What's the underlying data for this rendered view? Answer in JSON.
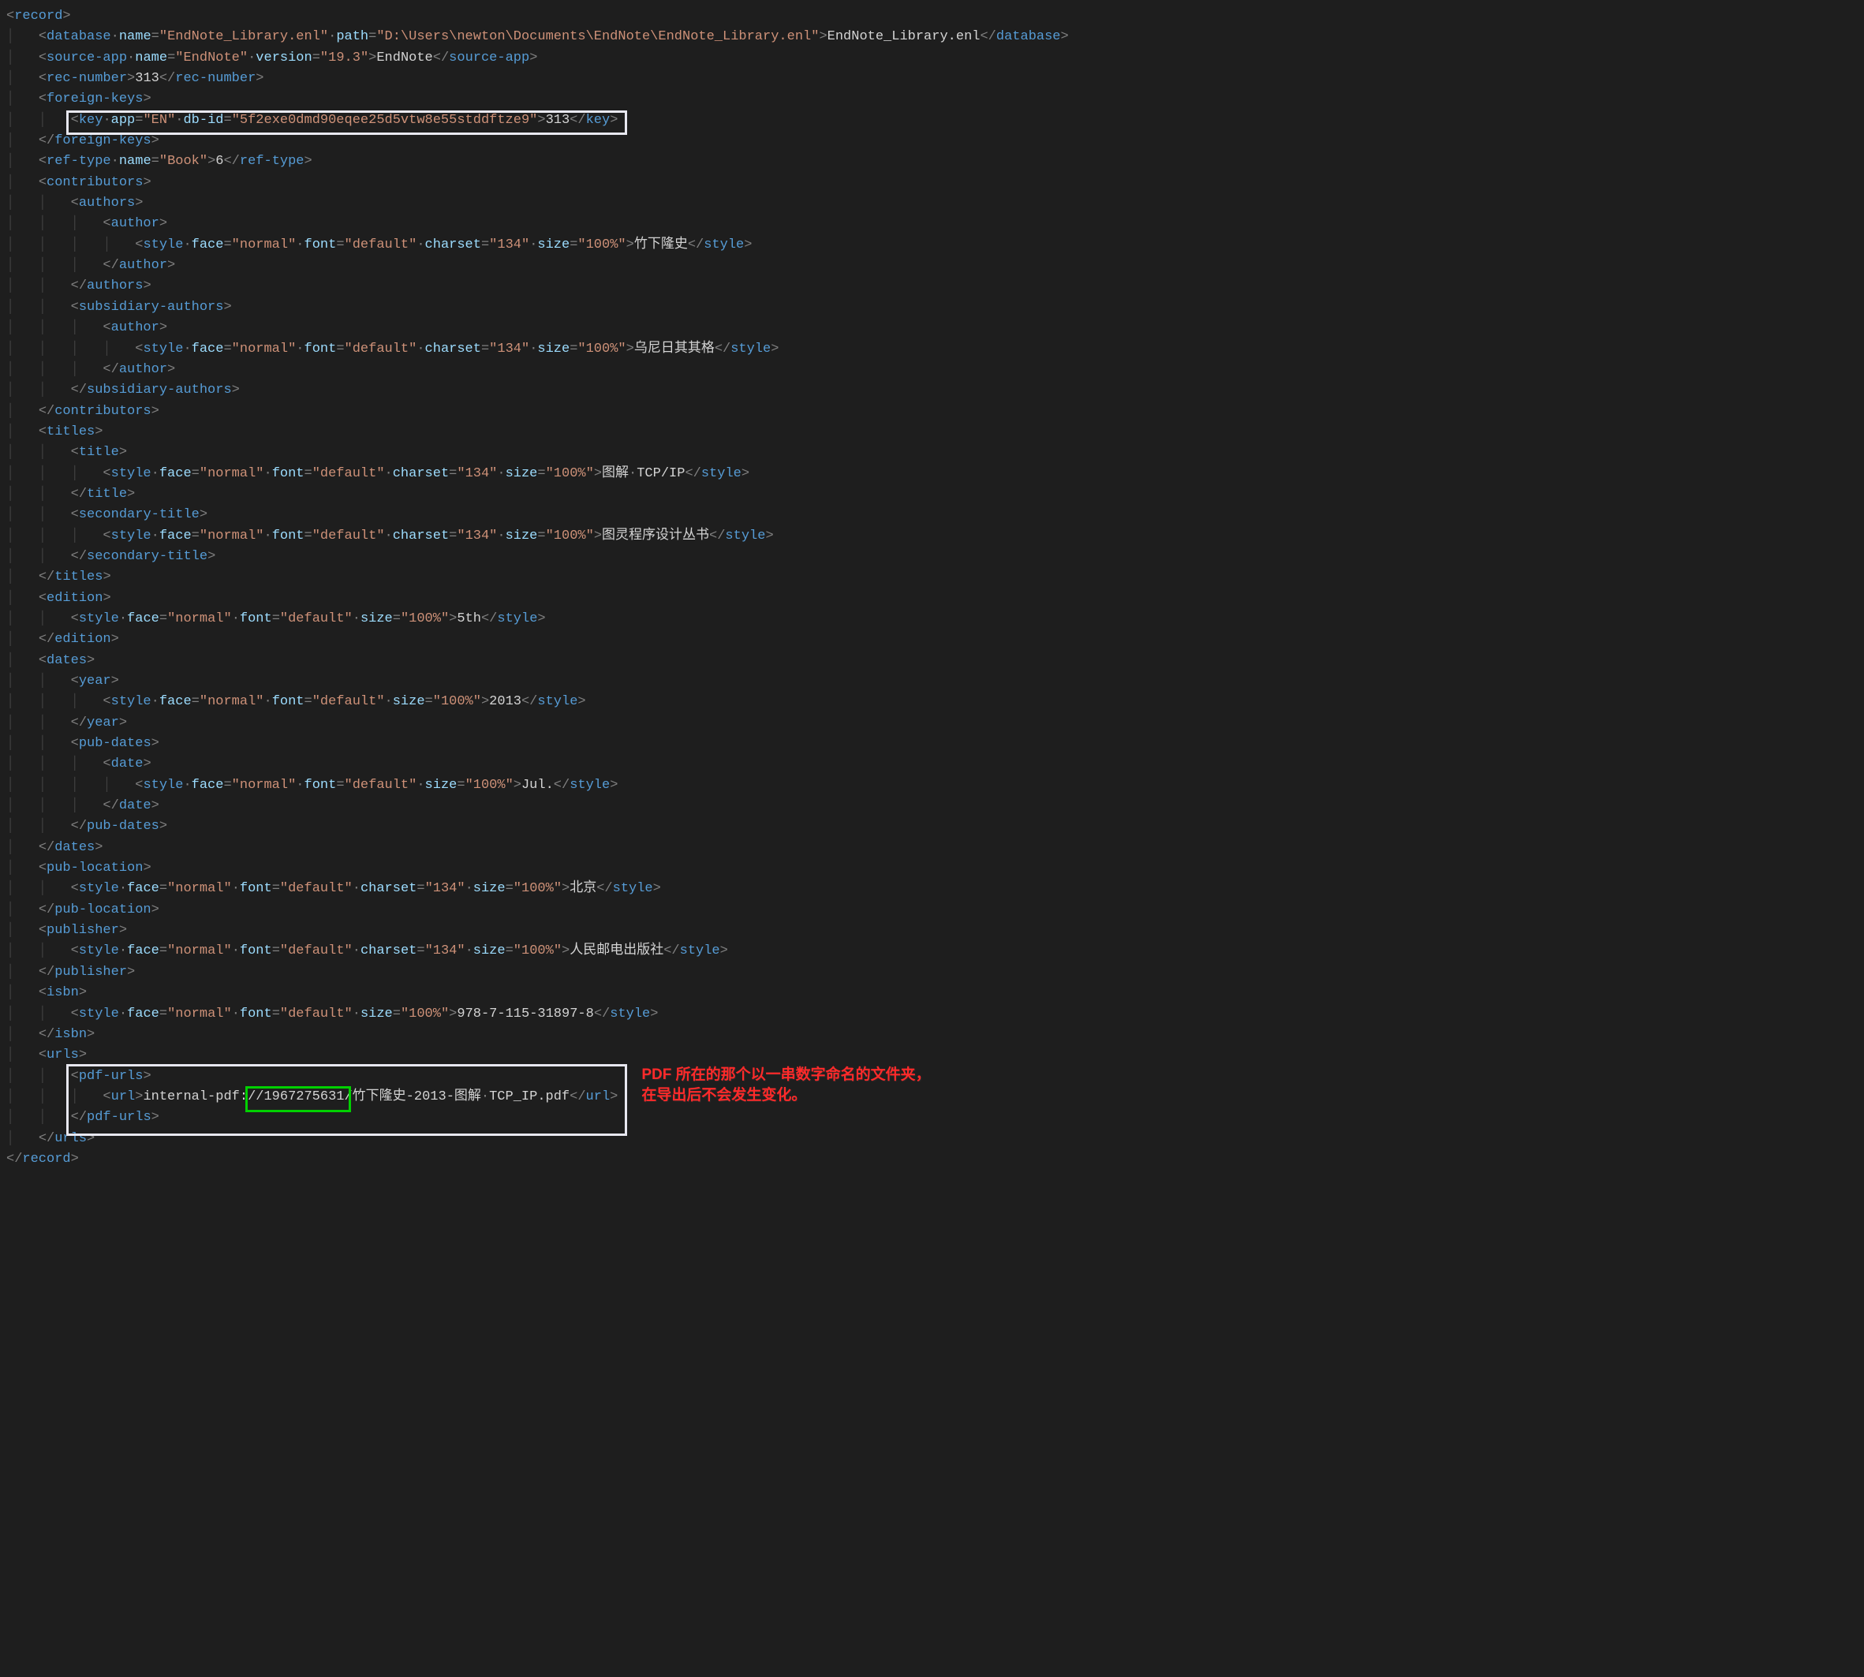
{
  "root_open": "record",
  "database": {
    "tag": "database",
    "name_attr": "name",
    "name_val": "EndNote_Library.enl",
    "path_attr": "path",
    "path_val": "D:\\Users\\newton\\Documents\\EndNote\\EndNote_Library.enl",
    "text": "EndNote_Library.enl"
  },
  "source_app": {
    "tag": "source-app",
    "name_attr": "name",
    "name_val": "EndNote",
    "version_attr": "version",
    "version_val": "19.3",
    "text": "EndNote"
  },
  "rec_number": {
    "tag": "rec-number",
    "text": "313"
  },
  "foreign_keys": {
    "tag": "foreign-keys",
    "key": {
      "tag": "key",
      "app_attr": "app",
      "app_val": "EN",
      "dbid_attr": "db-id",
      "dbid_val": "5f2exe0dmd90eqee25d5vtw8e55stddftze9",
      "text": "313"
    }
  },
  "ref_type": {
    "tag": "ref-type",
    "name_attr": "name",
    "name_val": "Book",
    "text": "6"
  },
  "contributors": {
    "tag": "contributors",
    "authors": {
      "tag": "authors",
      "author": {
        "tag": "author"
      }
    },
    "sub_authors": {
      "tag": "subsidiary-authors",
      "author": {
        "tag": "author"
      }
    }
  },
  "style_common": {
    "tag": "style",
    "face_attr": "face",
    "face_val": "normal",
    "font_attr": "font",
    "font_val": "default",
    "charset_attr": "charset",
    "charset_val": "134",
    "size_attr": "size",
    "size_val": "100%"
  },
  "author_name": "竹下隆史",
  "sub_author_name": "乌尼日其其格",
  "titles": {
    "tag": "titles",
    "title": {
      "tag": "title",
      "text": "图解"
    },
    "title_extra": "TCP/IP",
    "secondary": {
      "tag": "secondary-title",
      "text": "图灵程序设计丛书"
    }
  },
  "edition": {
    "tag": "edition",
    "text": "5th"
  },
  "dates": {
    "tag": "dates",
    "year": {
      "tag": "year",
      "text": "2013"
    },
    "pub_dates": {
      "tag": "pub-dates",
      "date": {
        "tag": "date",
        "text": "Jul."
      }
    }
  },
  "pub_location": {
    "tag": "pub-location",
    "text": "北京"
  },
  "publisher": {
    "tag": "publisher",
    "text": "人民邮电出版社"
  },
  "isbn": {
    "tag": "isbn",
    "text": "978-7-115-31897-8"
  },
  "urls": {
    "tag": "urls",
    "pdf_urls": {
      "tag": "pdf-urls",
      "url": {
        "tag": "url"
      }
    },
    "url_prefix": "internal-pdf:",
    "url_num": "//1967275631",
    "url_sep": "/竹下隆史-2013-图解",
    "url_end": "TCP_IP.pdf"
  },
  "annotation_line1": "PDF 所在的那个以一串数字命名的文件夹，",
  "annotation_line2": "在导出后不会发生变化。"
}
